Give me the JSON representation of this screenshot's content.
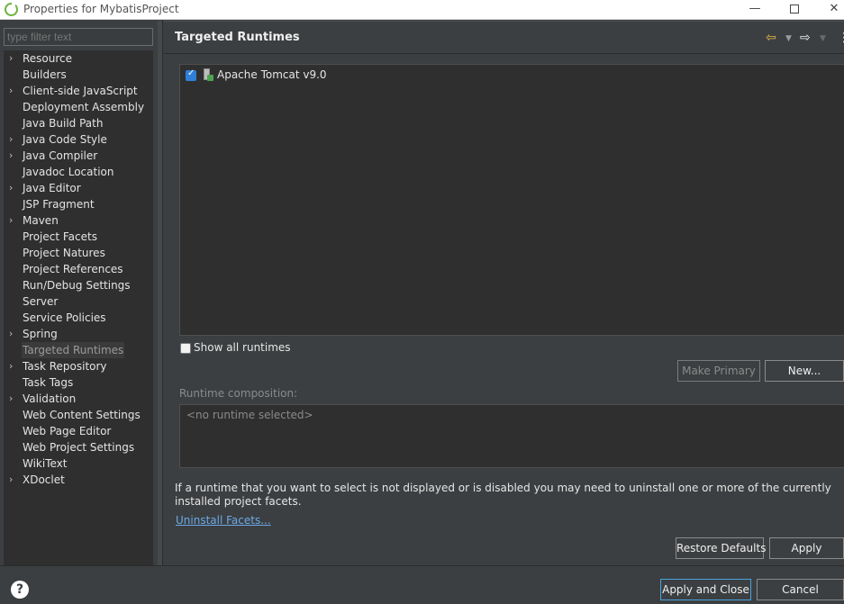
{
  "window": {
    "title": "Properties for MybatisProject",
    "minimize_glyph": "—",
    "close_glyph": "✕"
  },
  "filter": {
    "placeholder": "type filter text"
  },
  "tree": {
    "items": [
      {
        "label": "Resource",
        "expandable": true
      },
      {
        "label": "Builders",
        "expandable": false
      },
      {
        "label": "Client-side JavaScript",
        "expandable": true
      },
      {
        "label": "Deployment Assembly",
        "expandable": false
      },
      {
        "label": "Java Build Path",
        "expandable": false
      },
      {
        "label": "Java Code Style",
        "expandable": true
      },
      {
        "label": "Java Compiler",
        "expandable": true
      },
      {
        "label": "Javadoc Location",
        "expandable": false
      },
      {
        "label": "Java Editor",
        "expandable": true
      },
      {
        "label": "JSP Fragment",
        "expandable": false
      },
      {
        "label": "Maven",
        "expandable": true
      },
      {
        "label": "Project Facets",
        "expandable": false
      },
      {
        "label": "Project Natures",
        "expandable": false
      },
      {
        "label": "Project References",
        "expandable": false
      },
      {
        "label": "Run/Debug Settings",
        "expandable": false
      },
      {
        "label": "Server",
        "expandable": false
      },
      {
        "label": "Service Policies",
        "expandable": false
      },
      {
        "label": "Spring",
        "expandable": true
      },
      {
        "label": "Targeted Runtimes",
        "expandable": false,
        "selected": true
      },
      {
        "label": "Task Repository",
        "expandable": true
      },
      {
        "label": "Task Tags",
        "expandable": false
      },
      {
        "label": "Validation",
        "expandable": true
      },
      {
        "label": "Web Content Settings",
        "expandable": false
      },
      {
        "label": "Web Page Editor",
        "expandable": false
      },
      {
        "label": "Web Project Settings",
        "expandable": false
      },
      {
        "label": "WikiText",
        "expandable": false
      },
      {
        "label": "XDoclet",
        "expandable": true
      }
    ],
    "chevron": "›"
  },
  "page": {
    "title": "Targeted Runtimes",
    "runtimes": [
      {
        "name": "Apache Tomcat v9.0",
        "checked": true
      }
    ],
    "show_all_label": "Show all runtimes",
    "make_primary_label": "Make Primary",
    "new_label": "New...",
    "composition_label": "Runtime composition:",
    "composition_placeholder": "<no runtime selected>",
    "info_text": "If a runtime that you want to select is not displayed or is disabled you may need to uninstall one or more of the currently installed project facets.",
    "uninstall_link": "Uninstall Facets...",
    "restore_defaults_label": "Restore Defaults",
    "apply_label": "Apply"
  },
  "footer": {
    "help_glyph": "?",
    "apply_close_label": "Apply and Close",
    "cancel_label": "Cancel"
  },
  "colors": {
    "background": "#3c3f41",
    "list_background": "#2f2f2f",
    "checkbox_checked": "#2f7fd8",
    "link": "#6ba9e8",
    "back_arrow": "#e8b74a",
    "primary_button_border": "#4aa3df"
  }
}
